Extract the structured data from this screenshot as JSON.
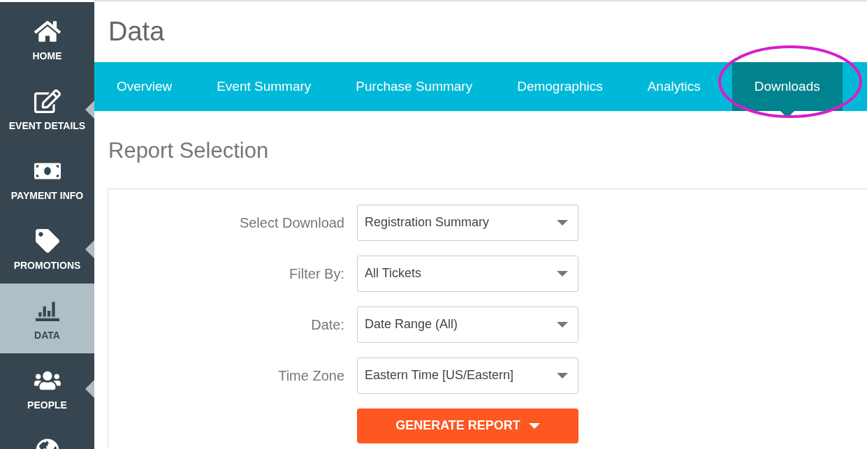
{
  "sidebar": {
    "items": [
      {
        "label": "HOME",
        "selected": false,
        "has_submenu": false
      },
      {
        "label": "EVENT DETAILS",
        "selected": false,
        "has_submenu": true
      },
      {
        "label": "PAYMENT INFO",
        "selected": false,
        "has_submenu": false
      },
      {
        "label": "PROMOTIONS",
        "selected": false,
        "has_submenu": true
      },
      {
        "label": "DATA",
        "selected": true,
        "has_submenu": false
      },
      {
        "label": "PEOPLE",
        "selected": false,
        "has_submenu": true
      },
      {
        "selected": false,
        "has_submenu": false
      }
    ]
  },
  "page_title": "Data",
  "tabs": [
    {
      "label": "Overview",
      "selected": false,
      "circled": false
    },
    {
      "label": "Event Summary",
      "selected": false,
      "circled": false
    },
    {
      "label": "Purchase Summary",
      "selected": false,
      "circled": false
    },
    {
      "label": "Demographics",
      "selected": false,
      "circled": false
    },
    {
      "label": "Analytics",
      "selected": false,
      "circled": false
    },
    {
      "label": "Downloads",
      "selected": true,
      "circled": true
    }
  ],
  "section_title": "Report Selection",
  "form": {
    "fields": [
      {
        "label": "Select Download",
        "value": "Registration Summary"
      },
      {
        "label": "Filter By:",
        "value": "All Tickets"
      },
      {
        "label": "Date:",
        "value": "Date Range (All)"
      },
      {
        "label": "Time Zone",
        "value": "Eastern Time [US/Eastern]"
      }
    ],
    "button": "GENERATE REPORT"
  }
}
